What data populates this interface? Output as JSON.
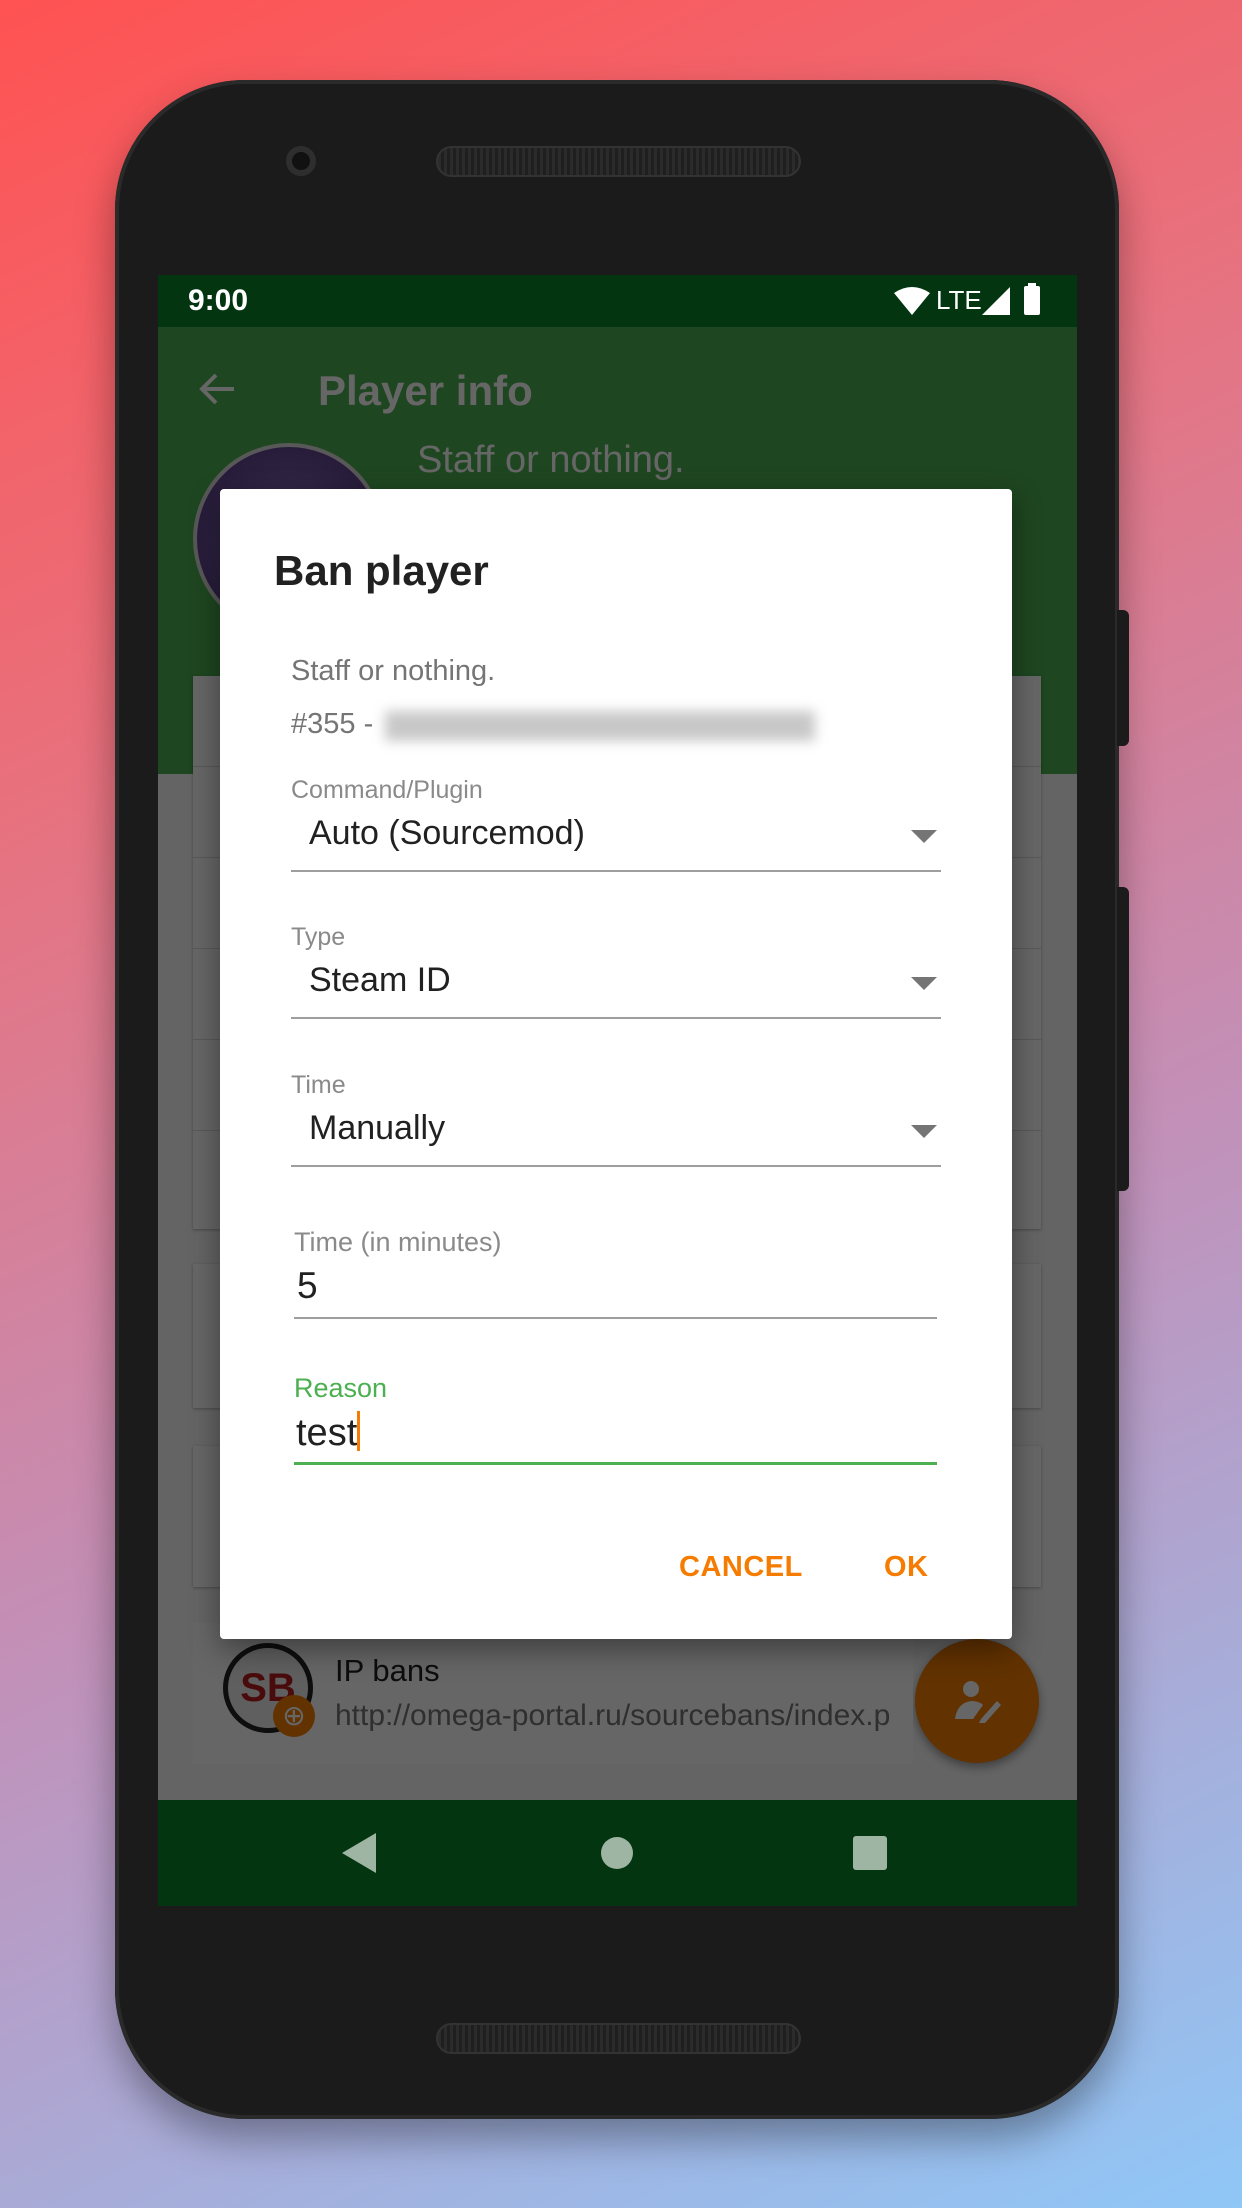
{
  "status_bar": {
    "time": "9:00",
    "network": "LTE",
    "icons": [
      "wifi-icon",
      "signal-icon",
      "battery-icon"
    ]
  },
  "app_bar": {
    "title": "Player info",
    "back_icon": "arrow-left-icon",
    "player_name": "Staff or nothing."
  },
  "background_list": {
    "ip_bans": {
      "title": "IP bans",
      "url": "http://omega-portal.ru/sourcebans/index.p",
      "icon": "sourcebans-logo"
    }
  },
  "fab": {
    "icon": "person-edit-icon",
    "color": "#f57c00"
  },
  "dialog": {
    "title": "Ban player",
    "player_name": "Staff or nothing.",
    "player_id_prefix": "#355 -",
    "fields": [
      {
        "label": "Command/Plugin",
        "value": "Auto (Sourcemod)",
        "type": "dropdown"
      },
      {
        "label": "Type",
        "value": "Steam ID",
        "type": "dropdown"
      },
      {
        "label": "Time",
        "value": "Manually",
        "type": "dropdown"
      }
    ],
    "minutes": {
      "label": "Time (in minutes)",
      "value": "5"
    },
    "reason": {
      "label": "Reason",
      "value": "test",
      "focused": true
    },
    "cancel_label": "CANCEL",
    "ok_label": "OK"
  },
  "colors": {
    "primary": "#4caf50",
    "primary_dark": "#033511",
    "accent": "#f57c00",
    "focus": "#4caf50"
  },
  "nav_bar": {
    "icons": [
      "back-triangle-icon",
      "home-circle-icon",
      "recents-square-icon"
    ]
  }
}
